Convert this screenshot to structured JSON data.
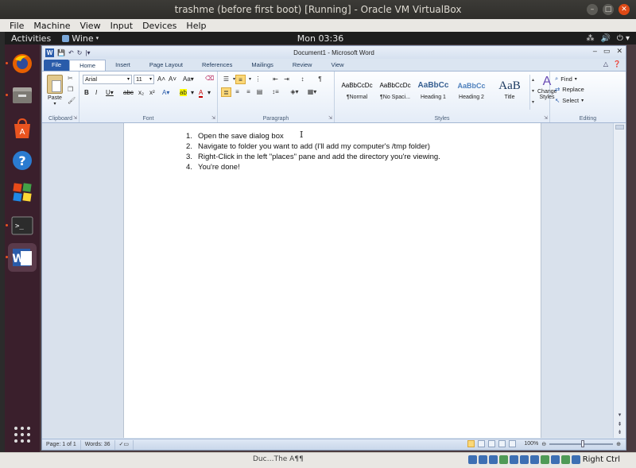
{
  "vbox": {
    "title": "trashme (before first boot) [Running] - Oracle VM VirtualBox",
    "menu": [
      "File",
      "Machine",
      "View",
      "Input",
      "Devices",
      "Help"
    ],
    "desk_text": "Duc…The A¶¶",
    "host_key": "Right Ctrl"
  },
  "gnome": {
    "activities": "Activities",
    "app_name": "Wine",
    "clock": "Mon 03:36",
    "tray": [
      "⁂",
      "🔊",
      "⏻ ▾"
    ]
  },
  "dock": {
    "items": [
      "firefox-icon",
      "files-icon",
      "software-center-icon",
      "help-icon",
      "wine-icon",
      "terminal-icon",
      "word-icon"
    ]
  },
  "word": {
    "doc_title": "Document1 - Microsoft Word",
    "tabs": [
      "File",
      "Home",
      "Insert",
      "Page Layout",
      "References",
      "Mailings",
      "Review",
      "View"
    ],
    "active_tab": "Home",
    "clipboard": {
      "paste_label": "Paste",
      "group_label": "Clipboard"
    },
    "font": {
      "name": "Arial",
      "size": "11",
      "group_label": "Font"
    },
    "paragraph": {
      "group_label": "Paragraph"
    },
    "styles": {
      "group_label": "Styles",
      "items": [
        {
          "preview": "AaBbCcDc",
          "name": "¶Normal"
        },
        {
          "preview": "AaBbCcDc",
          "name": "¶No Spaci..."
        },
        {
          "preview": "AaBbCc",
          "name": "Heading 1"
        },
        {
          "preview": "AaBbCc",
          "name": "Heading 2"
        },
        {
          "preview": "AaB",
          "name": "Title"
        }
      ],
      "change_styles": "Change Styles"
    },
    "editing": {
      "find": "Find",
      "replace": "Replace",
      "select": "Select",
      "group_label": "Editing"
    },
    "document": {
      "items": [
        "Open the save dialog box",
        "Navigate to folder you want to add (I'll add my computer's /tmp folder)",
        "Right-Click in the left \"places\" pane and add the directory you're viewing.",
        "You're done!"
      ]
    },
    "status": {
      "page": "Page: 1 of 1",
      "words": "Words: 36",
      "zoom": "100%",
      "zoom_level": 1.0
    }
  }
}
